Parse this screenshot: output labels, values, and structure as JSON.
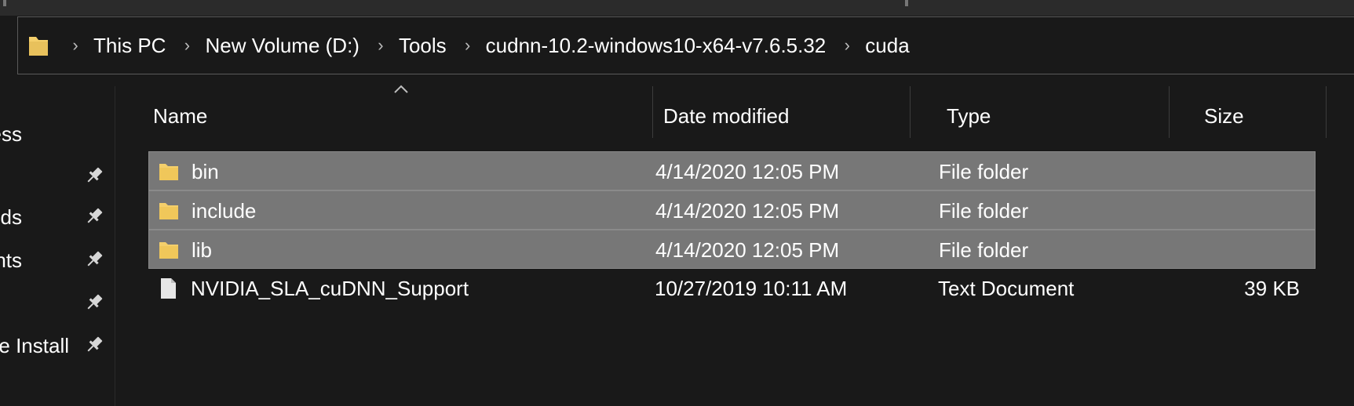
{
  "window": {
    "accent_colors": {
      "background": "#191919",
      "selection": "#777777",
      "folder_yellow": "#f4cf6b",
      "text": "#ffffff"
    }
  },
  "address_bar": {
    "root_icon": "folder-icon",
    "breadcrumbs": [
      {
        "label": "This PC"
      },
      {
        "label": "New Volume (D:)"
      },
      {
        "label": "Tools"
      },
      {
        "label": "cudnn-10.2-windows10-x64-v7.6.5.32"
      },
      {
        "label": "cuda"
      }
    ]
  },
  "nav_pane": {
    "items": [
      {
        "label": "ess",
        "pinned": false
      },
      {
        "label": "",
        "pinned": true
      },
      {
        "label": "ds",
        "pinned": true
      },
      {
        "label": "nts",
        "pinned": true
      },
      {
        "label": "",
        "pinned": true
      },
      {
        "label": "e Install",
        "pinned": true
      }
    ]
  },
  "file_list": {
    "sort_column": "Name",
    "columns": {
      "name": "Name",
      "date_modified": "Date modified",
      "type": "Type",
      "size": "Size"
    },
    "rows": [
      {
        "icon": "folder-icon",
        "name": "bin",
        "date_modified": "4/14/2020 12:05 PM",
        "type": "File folder",
        "size": "",
        "selected": true
      },
      {
        "icon": "folder-icon",
        "name": "include",
        "date_modified": "4/14/2020 12:05 PM",
        "type": "File folder",
        "size": "",
        "selected": true
      },
      {
        "icon": "folder-icon",
        "name": "lib",
        "date_modified": "4/14/2020 12:05 PM",
        "type": "File folder",
        "size": "",
        "selected": true
      },
      {
        "icon": "text-document-icon",
        "name": "NVIDIA_SLA_cuDNN_Support",
        "date_modified": "10/27/2019 10:11 AM",
        "type": "Text Document",
        "size": "39 KB",
        "selected": false
      }
    ]
  }
}
